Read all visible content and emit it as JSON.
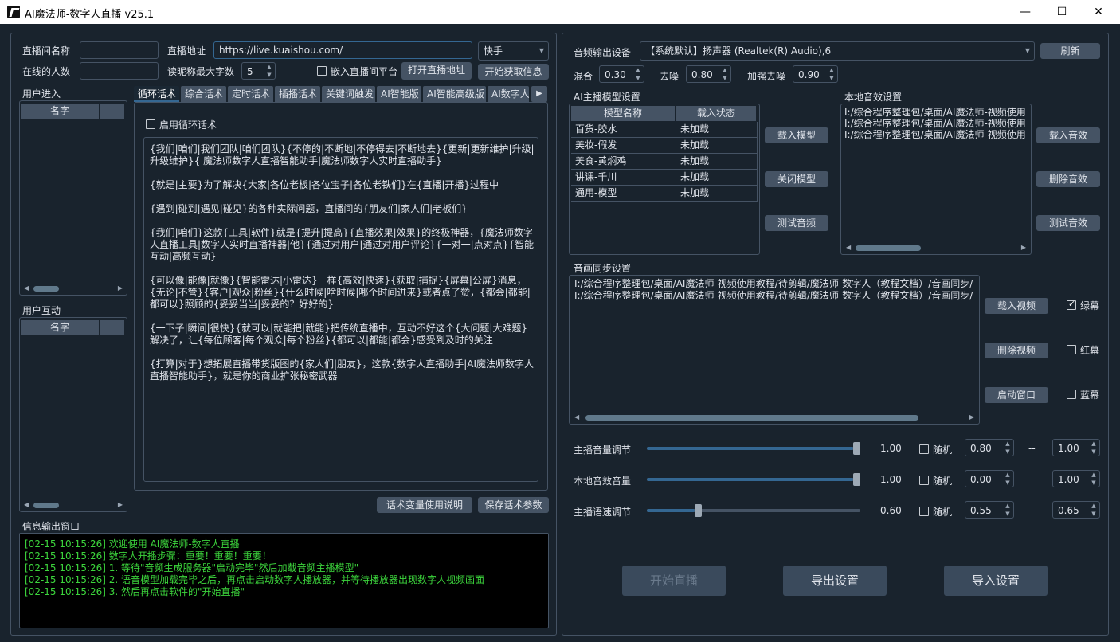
{
  "window": {
    "title": "AI魔法师-数字人直播 v25.1",
    "minimize": "—",
    "maximize": "☐",
    "close": "✕"
  },
  "room": {
    "name_label": "直播间名称",
    "name_value": "",
    "online_label": "在线的人数",
    "online_value": "",
    "url_label": "直播地址",
    "url_value": "https://live.kuaishou.com/",
    "platform_value": "快手",
    "nick_label": "读昵称最大字数",
    "nick_value": "5",
    "embed_label": "嵌入直播间平台",
    "open_button": "打开直播地址",
    "fetch_button": "开始获取信息"
  },
  "user_enter": {
    "title": "用户进入",
    "col": "名字"
  },
  "user_interact": {
    "title": "用户互动",
    "col": "名字"
  },
  "tabs": [
    "循环话术",
    "综合话术",
    "定时话术",
    "插播话术",
    "关键词触发",
    "AI智能版",
    "AI智能高级版",
    "AI数字人"
  ],
  "script": {
    "enable_label": "启用循环话术",
    "paragraphs": [
      "{我们|咱们|我们团队|咱们团队}{不停的|不断地|不停得去|不断地去}{更新|更新维护|升级|升级维护}{ 魔法师数字人直播智能助手|魔法师数字人实时直播助手}",
      "{就是|主要}为了解决{大家|各位老板|各位宝子|各位老铁们}在{直播|开播}过程中",
      "{遇到|碰到|遇见|碰见}的各种实际问题，直播间的{朋友们|家人们|老板们}",
      "{我们|咱们}这款{工具|软件}就是{提升|提高}{直播效果|效果}的终极神器，{魔法师数字人直播工具|数字人实时直播神器|他}{通过对用户|通过对用户评论}{一对一|点对点}{智能互动|高频互动}",
      "{可以像|能像|就像}{智能雷达|小雷达}一样{高效|快速}{获取|捕捉}{屏幕|公屏}消息，{无论|不管}{客户|观众|粉丝}{什么时候|啥时候|哪个时间进来}或者点了赞，{都会|都能|都可以}照顾的{妥妥当当|妥妥的？好好的}",
      "{一下子|瞬间|很快}{就可以|就能把|就能}把传统直播中，互动不好这个{大问题|大难题}解决了，让{每位顾客|每个观众|每个粉丝}{都可以|都能|都会}感受到及时的关注",
      "{打算|对于}想拓展直播带货版图的{家人们|朋友}，这款{数字人直播助手|AI魔法师数字人直播智能助手}，就是你的商业扩张秘密武器"
    ],
    "help_button": "话术变量使用说明",
    "save_button": "保存话术参数"
  },
  "log": {
    "title": "信息输出窗口",
    "lines": [
      "[02-15 10:15:26] 欢迎使用 AI魔法师-数字人直播",
      "[02-15 10:15:26] 数字人开播步骤：重要！重要！重要！",
      "[02-15 10:15:26] 1. 等待\"音频生成服务器\"启动完毕\"然后加载音频主播模型\"",
      "[02-15 10:15:26] 2. 语音模型加载完毕之后，再点击启动数字人播放器，并等待播放器出现数字人视频画面",
      "[02-15 10:15:26] 3. 然后再点击软件的\"开始直播\""
    ]
  },
  "audio": {
    "device_label": "音频输出设备",
    "device_value": "【系统默认】扬声器 (Realtek(R) Audio),6",
    "refresh_button": "刷新",
    "mix_label": "混合",
    "mix_value": "0.30",
    "denoise_label": "去噪",
    "denoise_value": "0.80",
    "strong_label": "加强去噪",
    "strong_value": "0.90"
  },
  "models": {
    "title": "AI主播模型设置",
    "headers": [
      "模型名称",
      "载入状态"
    ],
    "rows": [
      [
        "百货-胶水",
        "未加载"
      ],
      [
        "美妆-假发",
        "未加载"
      ],
      [
        "美食-黄焖鸡",
        "未加载"
      ],
      [
        "讲课-千川",
        "未加载"
      ],
      [
        "通用-模型",
        "未加载"
      ]
    ],
    "load_button": "载入模型",
    "close_button": "关闭模型",
    "test_button": "测试音频"
  },
  "local_fx": {
    "title": "本地音效设置",
    "items": [
      "I:/综合程序整理包/桌面/AI魔法师-视频使用",
      "I:/综合程序整理包/桌面/AI魔法师-视频使用",
      "I:/综合程序整理包/桌面/AI魔法师-视频使用"
    ],
    "load_button": "载入音效",
    "delete_button": "删除音效",
    "test_button": "测试音效"
  },
  "av_sync": {
    "title": "音画同步设置",
    "items": [
      "I:/综合程序整理包/桌面/AI魔法师-视频使用教程/待剪辑/魔法师-数字人（教程文档）/音画同步/",
      "I:/综合程序整理包/桌面/AI魔法师-视频使用教程/待剪辑/魔法师-数字人（教程文档）/音画同步/"
    ],
    "load_button": "载入视频",
    "delete_button": "删除视频",
    "start_button": "启动窗口",
    "green": "绿幕",
    "red": "红幕",
    "blue": "蓝幕"
  },
  "sliders": [
    {
      "label": "主播音量调节",
      "value": "1.00",
      "level": 1.0,
      "random": "随机",
      "min": "0.80",
      "dash": "--",
      "max": "1.00"
    },
    {
      "label": "本地音效音量",
      "value": "1.00",
      "level": 1.0,
      "random": "随机",
      "min": "0.00",
      "dash": "--",
      "max": "1.00"
    },
    {
      "label": "主播语速调节",
      "value": "0.60",
      "level": 0.12,
      "random": "随机",
      "min": "0.55",
      "dash": "--",
      "max": "0.65"
    }
  ],
  "actions": {
    "start": "开始直播",
    "export": "导出设置",
    "import": "导入设置"
  }
}
